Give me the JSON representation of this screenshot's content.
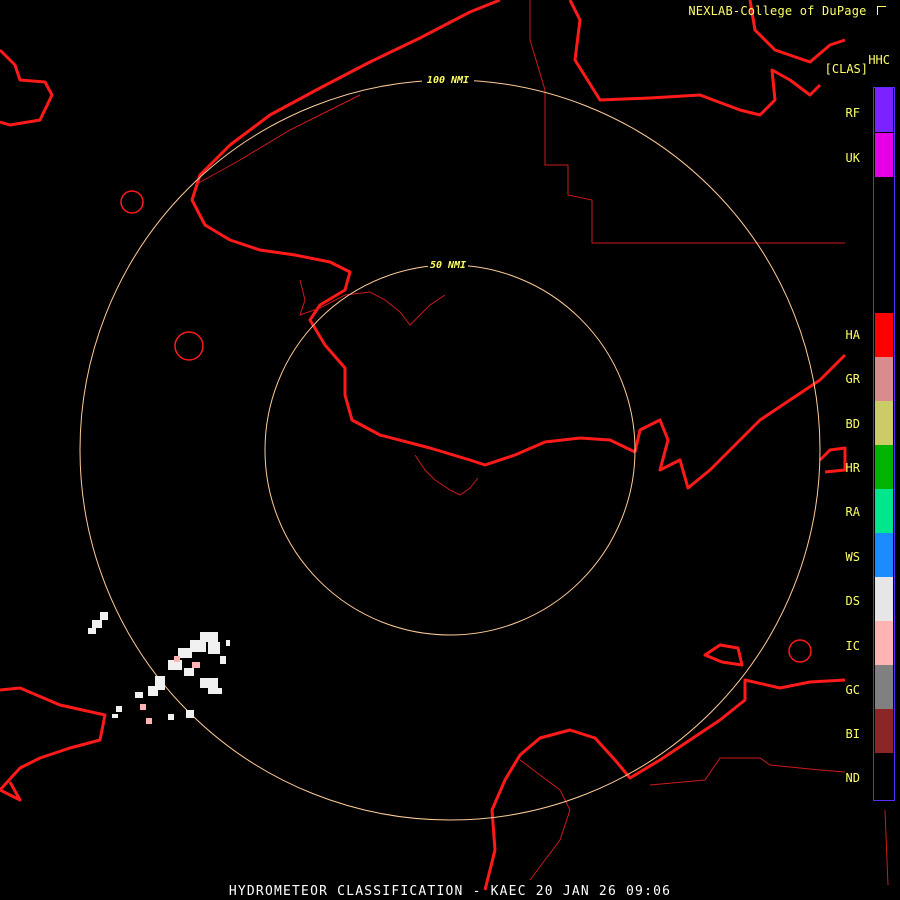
{
  "header": {
    "credit": "NEXLAB-College of DuPage",
    "product_code": "HHC",
    "product_type": "[CLAS]"
  },
  "range_rings": {
    "outer_label": "100 NMI",
    "inner_label": "50 NMI"
  },
  "legend": {
    "border_color": "#5a2cff",
    "items": [
      {
        "code": "RF",
        "color": "#7a22ff"
      },
      {
        "code": "UK",
        "color": "#e600e6"
      },
      {
        "code": "HA",
        "color": "#ff0000"
      },
      {
        "code": "GR",
        "color": "#d98c8c"
      },
      {
        "code": "BD",
        "color": "#cccc66"
      },
      {
        "code": "HR",
        "color": "#00b300"
      },
      {
        "code": "RA",
        "color": "#00e68c"
      },
      {
        "code": "WS",
        "color": "#1a8cff"
      },
      {
        "code": "DS",
        "color": "#e6e6e6"
      },
      {
        "code": "IC",
        "color": "#ffb3b3"
      },
      {
        "code": "GC",
        "color": "#808080"
      },
      {
        "code": "BI",
        "color": "#8c2626"
      },
      {
        "code": "ND",
        "color": "#000000"
      }
    ]
  },
  "footer": {
    "title": "HYDROMETEOR CLASSIFICATION - KAEC 20 JAN 26 09:06"
  },
  "colors": {
    "coastline": "#ff1a1a",
    "border": "#cc1a1a",
    "ring": "#ffcc99",
    "text": "#ffff66"
  }
}
